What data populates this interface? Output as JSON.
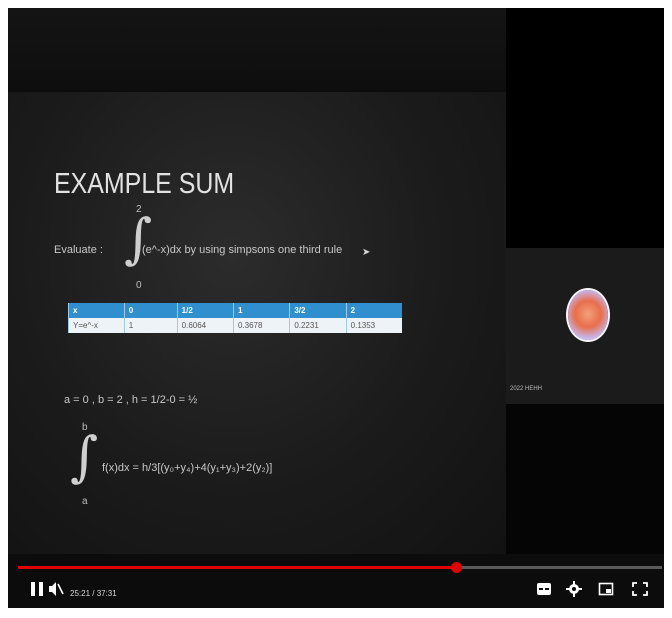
{
  "slide": {
    "title": "EXAMPLE SUM",
    "upper_limit": "2",
    "lower_limit": "0",
    "evaluate_label": "Evaluate :",
    "expression": "(e^-x)dx by using simpsons one third rule",
    "table": {
      "header": [
        "x",
        "0",
        "1/2",
        "1",
        "3/2",
        "2"
      ],
      "row": [
        "Y=e^-x",
        "1",
        "0.6064",
        "0.3678",
        "0.2231",
        "0.1353"
      ]
    },
    "step": "a = 0 , b = 2 , h = 1/2-0 = ½",
    "formula_upper": "b",
    "formula_lower": "a",
    "formula": "f(x)dx = h/3[(y₀+y₄)+4(y₁+y₃)+2(y₂)]"
  },
  "sidebar": {
    "participant_name": "2022 HEHH"
  },
  "player": {
    "time": "25:21 / 37:31",
    "progress": 0.68,
    "icons": [
      "pause-icon",
      "mute-icon",
      "subtitles-icon",
      "settings-icon",
      "miniplayer-icon",
      "fullscreen-icon"
    ],
    "accent": "#e00000"
  }
}
